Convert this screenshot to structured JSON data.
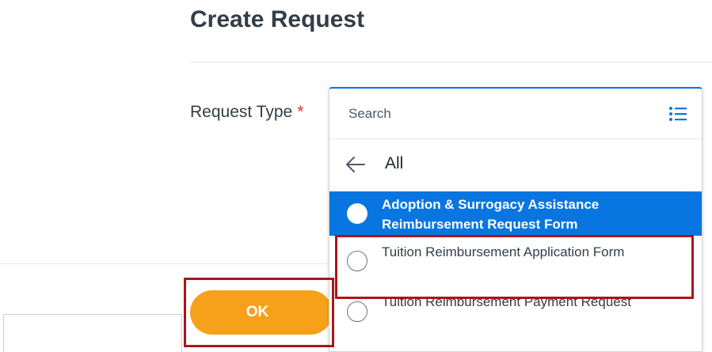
{
  "page": {
    "title": "Create Request"
  },
  "form": {
    "field_label": "Request Type",
    "required_marker": "*"
  },
  "dropdown": {
    "search_placeholder": "Search",
    "search_value": "",
    "list_icon": "list-view-icon",
    "back_icon": "back-arrow-icon",
    "back_label": "All",
    "options": [
      {
        "label": "Adoption & Surrogacy Assistance Reimbursement Request Form",
        "selected": true
      },
      {
        "label": "Tuition Reimbursement Application Form",
        "selected": false
      },
      {
        "label": "Tuition Reimbursement Payment Request",
        "selected": false
      }
    ]
  },
  "actions": {
    "ok_label": "OK"
  },
  "colors": {
    "accent_blue": "#0875e1",
    "ok_orange": "#f7a11a",
    "required_red": "#de2e21",
    "annotation_red": "#a8161c"
  }
}
